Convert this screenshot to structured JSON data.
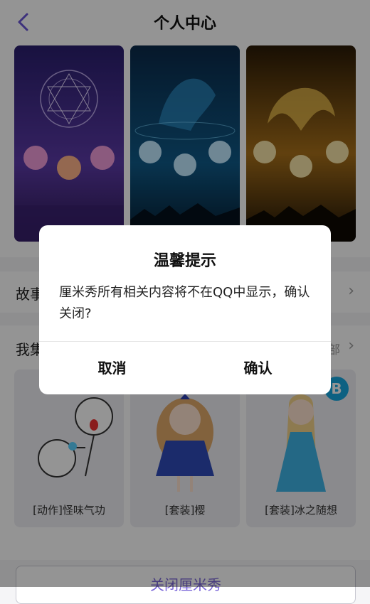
{
  "header": {
    "title": "个人中心"
  },
  "banners": [
    {
      "label": ""
    },
    {
      "label": ""
    },
    {
      "label": ""
    }
  ],
  "story": {
    "label": "故事"
  },
  "collection": {
    "label": "我集",
    "more": "部",
    "items": [
      {
        "name": "[动作]怪味气功"
      },
      {
        "name": "[套装]樱"
      },
      {
        "name": "[套装]冰之随想",
        "badge": "B"
      }
    ]
  },
  "bottom_button": {
    "label": "关闭厘米秀"
  },
  "dialog": {
    "title": "温馨提示",
    "message": "厘米秀所有相关内容将不在QQ中显示，确认关闭?",
    "cancel": "取消",
    "confirm": "确认"
  },
  "colors": {
    "accent": "#7a66d8",
    "overlay": "rgba(0,0,0,0.42)",
    "badge": "#18a8e0"
  }
}
